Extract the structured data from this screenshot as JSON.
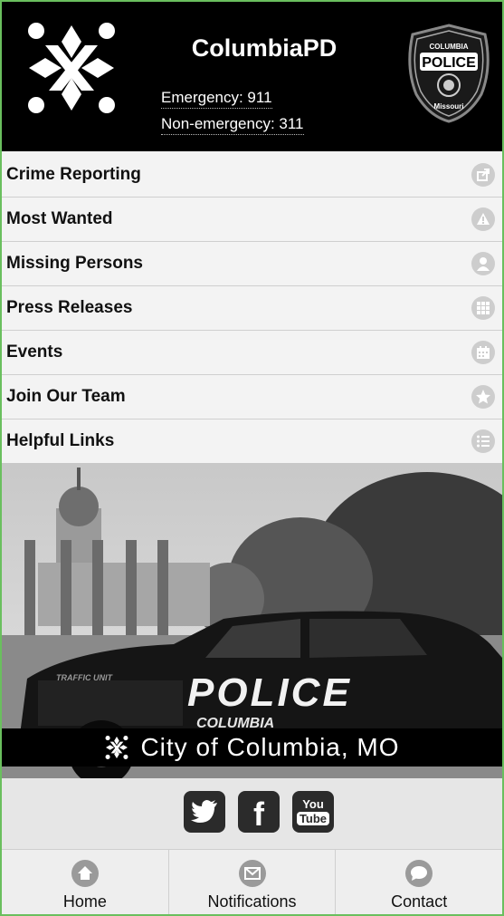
{
  "header": {
    "app_title": "ColumbiaPD",
    "emergency": "Emergency: 911",
    "non_emergency": "Non-emergency: 311",
    "badge": {
      "top": "COLUMBIA",
      "middle": "POLICE",
      "bottom": "Missouri"
    }
  },
  "menu": {
    "items": [
      {
        "label": "Crime Reporting",
        "icon": "share-icon"
      },
      {
        "label": "Most Wanted",
        "icon": "warning-icon"
      },
      {
        "label": "Missing Persons",
        "icon": "person-icon"
      },
      {
        "label": "Press Releases",
        "icon": "grid-icon"
      },
      {
        "label": "Events",
        "icon": "calendar-icon"
      },
      {
        "label": "Join Our Team",
        "icon": "star-icon"
      },
      {
        "label": "Helpful Links",
        "icon": "list-icon"
      }
    ]
  },
  "hero": {
    "caption": "City of Columbia, MO",
    "car_text": "POLICE",
    "car_sub": "COLUMBIA",
    "car_unit": "TRAFFIC UNIT"
  },
  "social": {
    "twitter": "twitter-icon",
    "facebook": "f",
    "youtube_top": "You",
    "youtube_bottom": "Tube"
  },
  "tabs": [
    {
      "label": "Home",
      "icon": "home-icon"
    },
    {
      "label": "Notifications",
      "icon": "envelope-icon"
    },
    {
      "label": "Contact",
      "icon": "chat-icon"
    }
  ],
  "colors": {
    "border": "#6abf5e",
    "header_bg": "#000000",
    "menu_bg": "#f3f3f3",
    "icon_gray": "#cdcdcd"
  }
}
